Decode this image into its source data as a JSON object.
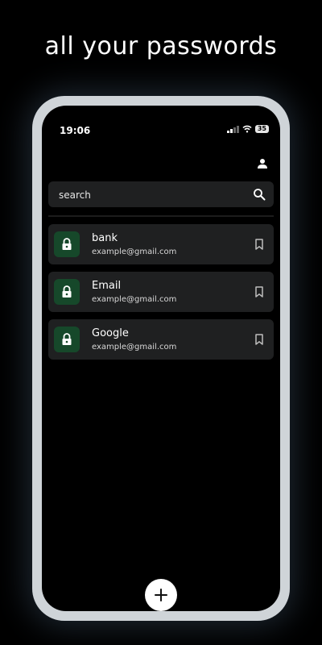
{
  "headline": "all your passwords",
  "status_bar": {
    "time": "19:06",
    "battery": "35"
  },
  "search": {
    "placeholder": "search"
  },
  "entries": [
    {
      "title": "bank",
      "subtitle": "example@gmail.com",
      "icon": "lock-icon"
    },
    {
      "title": "Email",
      "subtitle": "example@gmail.com",
      "icon": "lock-icon"
    },
    {
      "title": "Google",
      "subtitle": "example@gmail.com",
      "icon": "lock-icon"
    }
  ],
  "icons": {
    "profile": "person-icon",
    "search": "search-icon",
    "bookmark": "bookmark-icon",
    "add": "plus-icon"
  },
  "colors": {
    "background": "#000000",
    "card": "#1f2021",
    "lock_tile": "#16482a",
    "frame": "#cfd4d8"
  }
}
